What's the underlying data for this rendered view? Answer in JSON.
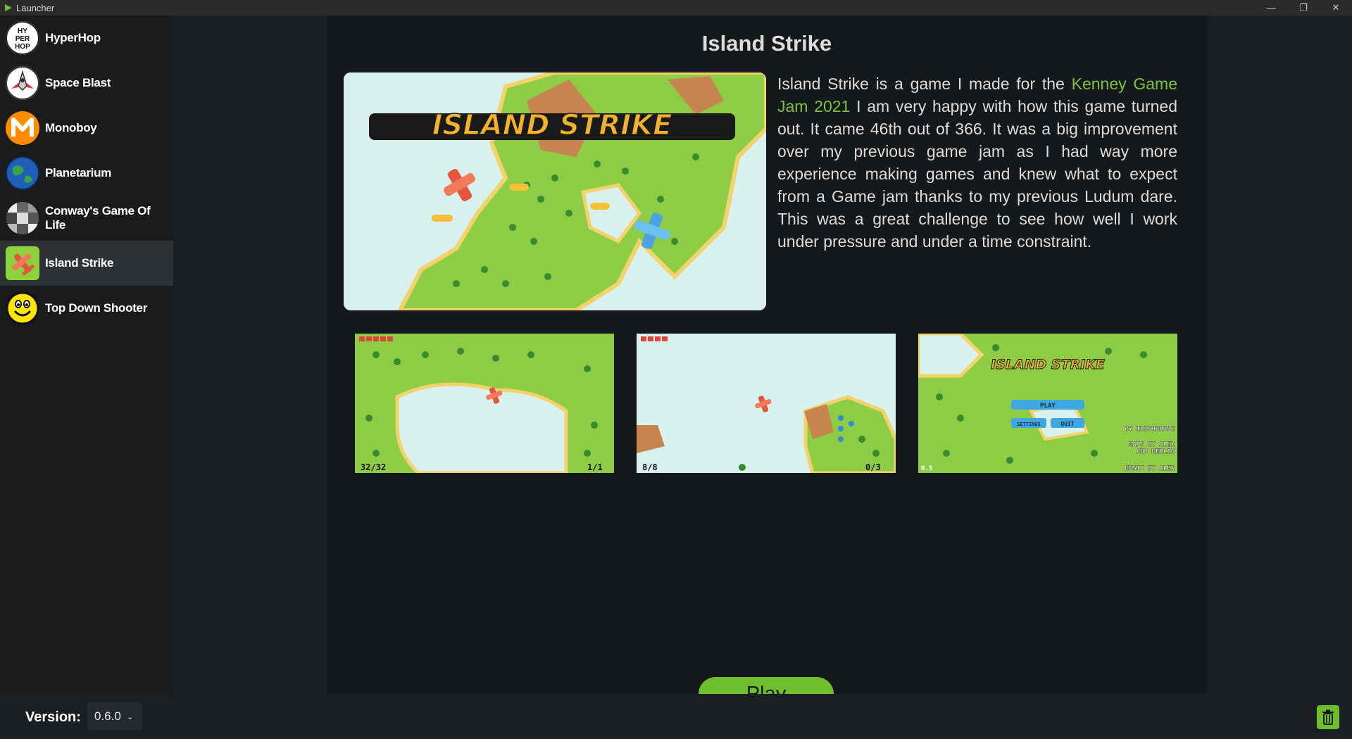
{
  "window": {
    "title": "Launcher",
    "minimize_glyph": "—",
    "restore_glyph": "❐",
    "close_glyph": "✕"
  },
  "sidebar": {
    "items": [
      {
        "label": "HyperHop",
        "icon": "hyperhop-icon",
        "active": false
      },
      {
        "label": "Space Blast",
        "icon": "space-blast-icon",
        "active": false
      },
      {
        "label": "Monoboy",
        "icon": "monoboy-icon",
        "active": false
      },
      {
        "label": "Planetarium",
        "icon": "planetarium-icon",
        "active": false
      },
      {
        "label": "Conway's Game Of Life",
        "icon": "conway-icon",
        "active": false
      },
      {
        "label": "Island Strike",
        "icon": "island-strike-icon",
        "active": true
      },
      {
        "label": "Top Down Shooter",
        "icon": "top-down-shooter-icon",
        "active": false
      }
    ]
  },
  "main": {
    "title": "Island Strike",
    "hero_logo_text": "ISLAND STRIKE",
    "description": {
      "before_link": "Island Strike is a game I made for the ",
      "link": "Kenney Game Jam 2021",
      "after_link": " I am very happy with how this game turned out. It came 46th out of 366. It was a big improvement over my previous game jam as I had way more experience making games and knew what to expect from a Game jam thanks to my previous Ludum dare. This was a great challenge to see how well I work under pressure and under a time constraint."
    },
    "screenshots": [
      {
        "hud_left": "32/32",
        "hud_right": "1/1"
      },
      {
        "hud_left": "8/8",
        "hud_right": "0/3"
      },
      {
        "logo": "ISLAND STRIKE",
        "play": "PLAY",
        "settings": "SETTINGS",
        "quit": "QUIT",
        "credits": [
          "BY IRISHBRUSE",
          "MAPS BY ALEX",
          "AND MERLIN",
          "MUSIC BY ALEX"
        ],
        "version": "0.5"
      }
    ],
    "play_label": "Play"
  },
  "footer": {
    "version_label": "Version:",
    "version_value": "0.6.0"
  },
  "colors": {
    "accent": "#6fbe2d",
    "link": "#7cc142"
  }
}
